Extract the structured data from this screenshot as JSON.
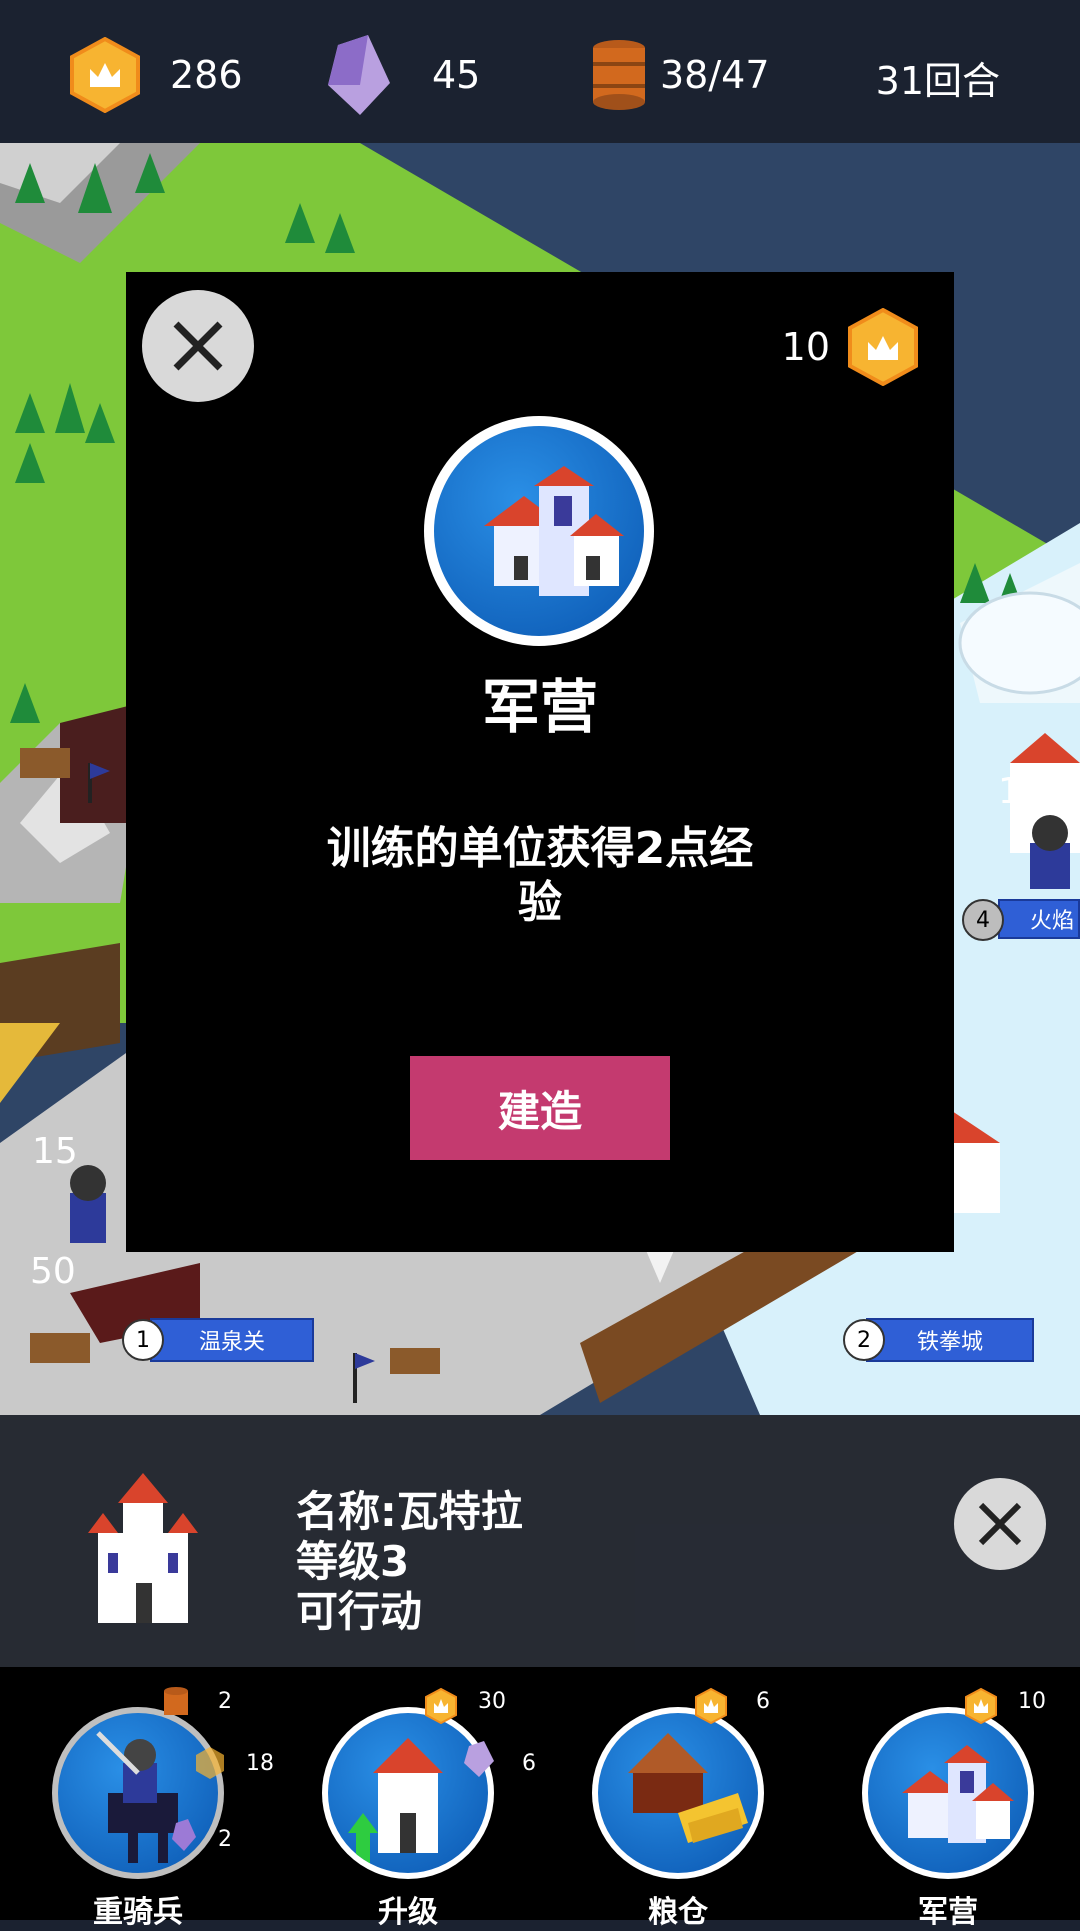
{
  "topbar": {
    "gold": "286",
    "gems": "45",
    "food": "38/47",
    "turn": "31回合"
  },
  "modal": {
    "cost": "10",
    "title": "军营",
    "description": "训练的单位获得2点经验",
    "build_label": "建造"
  },
  "map": {
    "cities": [
      {
        "num": "1",
        "name": "温泉关"
      },
      {
        "num": "2",
        "name": "铁拳城"
      },
      {
        "num": "4",
        "name": "火焰"
      }
    ],
    "unit_hp": [
      "15",
      "50",
      "15"
    ]
  },
  "info": {
    "name": "名称:瓦特拉",
    "level": "等级3",
    "status": "可行动"
  },
  "actions": [
    {
      "label": "重骑兵",
      "costs": [
        "2",
        "18",
        "2"
      ]
    },
    {
      "label": "升级",
      "costs": [
        "30",
        "6"
      ]
    },
    {
      "label": "粮仓",
      "costs": [
        "6"
      ]
    },
    {
      "label": "军营",
      "costs": [
        "10"
      ]
    }
  ],
  "colors": {
    "build_button": "#c43a6f",
    "city_label": "#2f5fd6",
    "grass": "#7ec83a",
    "snow": "#d8f1fb"
  }
}
